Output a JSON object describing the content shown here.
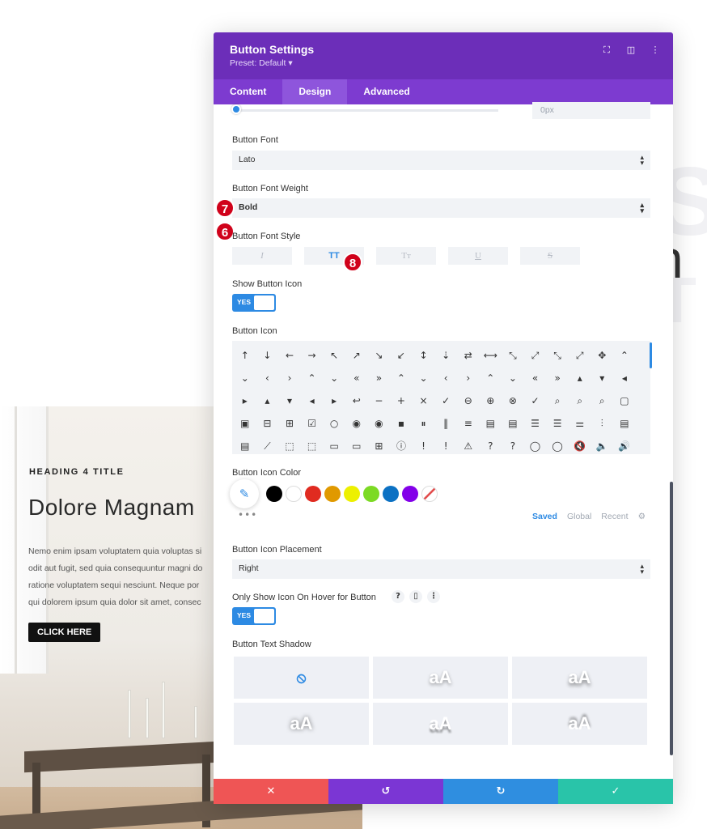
{
  "background": {
    "hero": {
      "eyebrow": "HEADING 4 TITLE",
      "title": "Dolore Magnam",
      "body_lines": [
        "Nemo enim ipsam voluptatem quia voluptas si",
        "odit aut fugit, sed quia consequuntur magni do",
        "ratione voluptatem sequi nesciunt. Neque por",
        "qui dolorem ipsum quia dolor sit amet, consec"
      ],
      "button_label": "CLICK HERE"
    },
    "side_letter": "n"
  },
  "modal": {
    "title": "Button Settings",
    "preset": "Preset: Default ▾",
    "tabs": [
      {
        "label": "Content",
        "active": false
      },
      {
        "label": "Design",
        "active": true
      },
      {
        "label": "Advanced",
        "active": false
      }
    ],
    "slider": {
      "value": "0px"
    },
    "fields": {
      "button_font": {
        "label": "Button Font",
        "value": "Lato",
        "marker": "6"
      },
      "button_font_weight": {
        "label": "Button Font Weight",
        "value": "Bold",
        "marker": "7"
      },
      "button_font_style": {
        "label": "Button Font Style",
        "marker": "8",
        "options": [
          "I",
          "TT",
          "Tт",
          "U",
          "S"
        ],
        "active_index": 1
      },
      "show_button_icon": {
        "label": "Show Button Icon",
        "toggle": "YES"
      },
      "button_icon": {
        "label": "Button Icon"
      },
      "button_icon_color": {
        "label": "Button Icon Color",
        "swatches": [
          "#000000",
          "#ffffff",
          "#e02b20",
          "#e09900",
          "#edf000",
          "#7cda24",
          "#0c71c3",
          "#8300e9"
        ],
        "more": "•••",
        "tabs": [
          "Saved",
          "Global",
          "Recent"
        ]
      },
      "button_icon_placement": {
        "label": "Button Icon Placement",
        "value": "Right"
      },
      "only_show_icon_on_hover": {
        "label": "Only Show Icon On Hover for Button",
        "toggle": "YES"
      },
      "button_text_shadow": {
        "label": "Button Text Shadow",
        "sample": "aA"
      }
    },
    "icon_rows": [
      [
        "↑",
        "↓",
        "←",
        "→",
        "↖",
        "↗",
        "↘",
        "↙",
        "↕",
        "⇣",
        "⇄",
        "⟷",
        "⤡",
        "⤢",
        "⤡",
        "⤢",
        "✥",
        "⌃"
      ],
      [
        "⌄",
        "‹",
        "›",
        "⌃",
        "⌄",
        "«",
        "»",
        "⌃",
        "⌄",
        "‹",
        "›",
        "⌃",
        "⌄",
        "«",
        "»",
        "▴",
        "▾",
        "◂"
      ],
      [
        "▸",
        "▴",
        "▾",
        "◂",
        "▸",
        "↩",
        "−",
        "+",
        "×",
        "✓",
        "⊖",
        "⊕",
        "⊗",
        "✓",
        "⌕",
        "⌕",
        "⌕",
        "▢"
      ],
      [
        "▣",
        "⊟",
        "⊞",
        "☑",
        "○",
        "◉",
        "◉",
        "▪",
        "⏸",
        "‖",
        "≡",
        "▤",
        "▤",
        "☰",
        "☰",
        "⚌",
        "⫶",
        "▤"
      ],
      [
        "▤",
        "⟋",
        "⬚",
        "⬚",
        "▭",
        "▭",
        "⊞",
        "ⓘ",
        "!",
        "!",
        "⚠",
        "?",
        "?",
        "◯",
        "◯",
        "🔇",
        "🔈",
        "🔊"
      ]
    ],
    "footer": {
      "cancel": "✕",
      "undo": "↺",
      "redo": "↻",
      "save": "✓"
    }
  }
}
